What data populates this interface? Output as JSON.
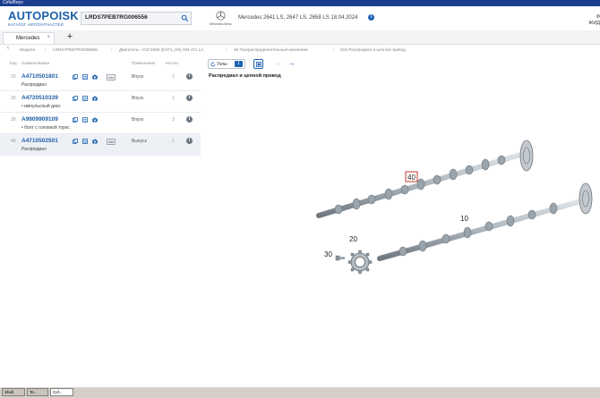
{
  "window": {
    "title": "CefulKeys"
  },
  "header": {
    "logo": "AUTOPOISK",
    "logo_sub": "КАТАЛОГ АВТОЗАПЧАСТЕЙ",
    "vin": "LRDS7PEB7RG006556",
    "brand_caption": "Mercedes-Benz",
    "vehicle": "Mercedes 2641 LS, 2647 LS, 2658 LS 18.04.2024",
    "right_text_1": "Ф",
    "right_text_2": "ЖИД"
  },
  "tabs": [
    {
      "label": "Mercedes",
      "close": "×"
    }
  ],
  "tab_add_label": "+",
  "breadcrumb": {
    "back": "‹",
    "items": [
      "Модели",
      "LRDS7PEB7RG006556",
      "Двигатель › D471968 (D471_H6) OM 471 LA",
      "05 Газораспределительный механизм",
      "015 Распредвал и цепной привод"
    ],
    "separator": "›"
  },
  "table": {
    "headers": {
      "code": "Код",
      "name": "Наименование",
      "applicability": "Применение",
      "qty": "Кол-во"
    },
    "rows": [
      {
        "pos": "10",
        "part_number": "A4710501801",
        "description": "Распредвал",
        "badge": "AM",
        "applicability": "Впуск",
        "qty": "1",
        "selected": false
      },
      {
        "pos": "20",
        "part_number": "A4720510339",
        "description": "• импульсный диск",
        "badge": "",
        "applicability": "Впуск",
        "qty": "1",
        "selected": false
      },
      {
        "pos": "30",
        "part_number": "A9909909109",
        "description": "• болт с головкой торкс",
        "badge": "",
        "applicability": "Впуск",
        "qty": "3",
        "selected": false
      },
      {
        "pos": "40",
        "part_number": "A4710502501",
        "description": "Распредвал",
        "badge": "AM",
        "applicability": "Выпуск",
        "qty": "1",
        "selected": true
      }
    ]
  },
  "toolbar": {
    "nodes_label": "Узлы",
    "nodes_count": "1"
  },
  "diagram": {
    "title": "Распредвал и цепной привод",
    "callouts": [
      "40",
      "10",
      "20",
      "30"
    ]
  },
  "taskbar": {
    "items": [
      "Shell",
      "Te...",
      "Cef..."
    ]
  },
  "colors": {
    "brand_blue": "#1d5fa8",
    "accent_blue": "#1f63b2",
    "titlebar": "#1a3d8f",
    "highlight_callout": "#c0392b"
  }
}
